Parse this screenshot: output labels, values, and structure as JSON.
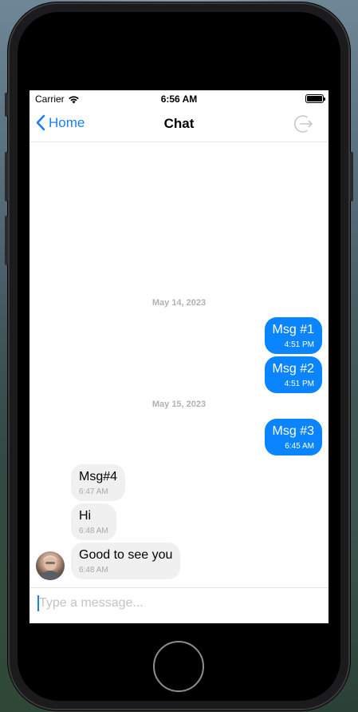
{
  "status_bar": {
    "carrier": "Carrier",
    "time": "6:56 AM",
    "battery_level": 1.0
  },
  "navbar": {
    "back_label": "Home",
    "title": "Chat",
    "back_icon": "chevron-left-icon",
    "logout_icon": "logout-icon"
  },
  "messages": {
    "date_1": "May 14, 2023",
    "date_2": "May 15, 2023",
    "items": [
      {
        "text": "Msg #1",
        "time": "4:51 PM",
        "direction": "out"
      },
      {
        "text": "Msg #2",
        "time": "4:51 PM",
        "direction": "out"
      },
      {
        "text": "Msg #3",
        "time": "6:45 AM",
        "direction": "out"
      },
      {
        "text": "Msg#4",
        "time": "6:47 AM",
        "direction": "in"
      },
      {
        "text": "Hi",
        "time": "6:48 AM",
        "direction": "in"
      },
      {
        "text": "Good to see you",
        "time": "6:48 AM",
        "direction": "in"
      }
    ]
  },
  "composer": {
    "placeholder": "Type a message...",
    "value": ""
  },
  "colors": {
    "accent": "#1a7ff5",
    "outgoing_bubble": "#0a84ff",
    "incoming_bubble": "#f0f0f0"
  }
}
